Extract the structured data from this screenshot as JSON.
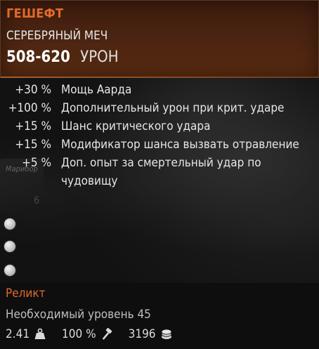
{
  "header": {
    "name": "ГЕШЕФТ",
    "type": "СЕРЕБРЯНЫЙ МЕЧ",
    "damage_value": "508-620",
    "damage_label": "УРОН"
  },
  "stats": [
    {
      "value": "+30 %",
      "text": "Мощь Аарда"
    },
    {
      "value": "+100 %",
      "text": "Дополнительный урон при крит. ударе"
    },
    {
      "value": "+15 %",
      "text": "Шанс критического удара"
    },
    {
      "value": "+15 %",
      "text": "Модификатор шанса вызвать отравление"
    },
    {
      "value": "+5 %",
      "text": "Доп. опыт за смертельный удар по чудовищу"
    }
  ],
  "background_card": {
    "title": "Марибор",
    "number": "6"
  },
  "sockets": 3,
  "rarity": "Реликт",
  "requirement": "Необходимый уровень 45",
  "footer": {
    "weight": "2.41",
    "weight_icon": "weight-icon",
    "durability": "100 %",
    "durability_icon": "hammer-icon",
    "price": "3196",
    "price_icon": "coins-icon"
  },
  "colors": {
    "accent": "#e16a2a",
    "header_bg": "#4a2412",
    "text": "#e6e6e6"
  }
}
